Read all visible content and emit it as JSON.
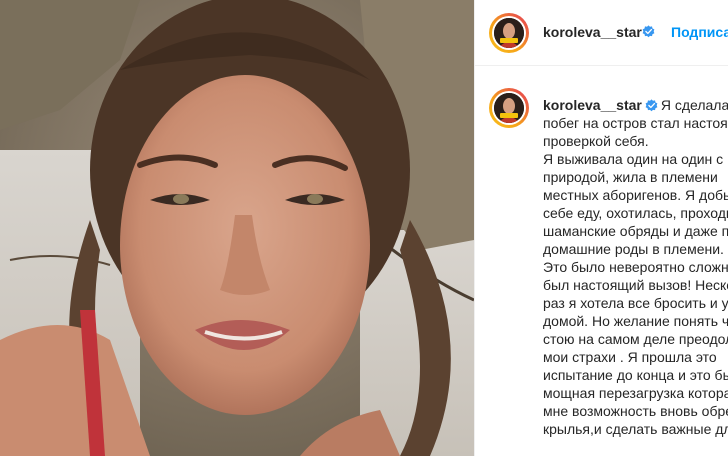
{
  "post": {
    "username": "koroleva__star",
    "subscribe_label": "Подписаться",
    "media_alt": "Photo of a woman on a beach",
    "caption_lines": [
      "Я сделала это! Мой",
      "побег на остров стал настоящей",
      "проверкой себя.",
      "Я выживала один на один с",
      "природой, жила в племени",
      "местных аборигенов. Я добывала",
      "себе еду, охотилась, проходила",
      "шаманские обряды и даже принимала",
      "домашние роды в племени.",
      "Это было невероятно сложно и это",
      "был настоящий вызов! Несколько",
      "раз я хотела все бросить и улететь",
      "домой. Но желание понять чего я",
      "стою на самом деле преодолеть",
      "мои страхи . Я прошла это",
      "испытание до конца и это была",
      "мощная перезагрузка которая дала",
      "мне возможность вновь обрести",
      "крылья,и сделать важные для"
    ]
  },
  "colors": {
    "accent": "#0095f6",
    "text": "#262626",
    "verified": "#3897f0"
  },
  "icons": {
    "verified": "verified-badge-icon"
  }
}
